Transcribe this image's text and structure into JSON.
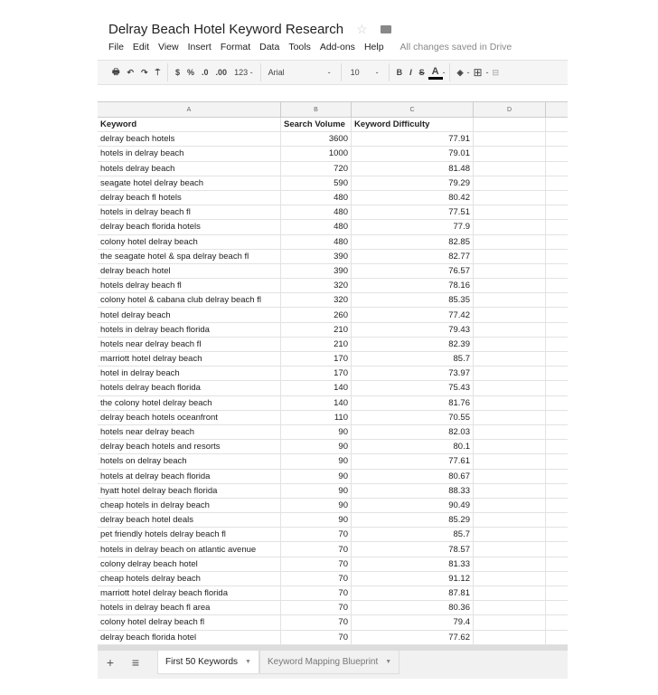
{
  "doc": {
    "title": "Delray Beach Hotel Keyword Research",
    "star_icon": "star-icon",
    "folder_icon": "folder-icon"
  },
  "menu": [
    "File",
    "Edit",
    "View",
    "Insert",
    "Format",
    "Data",
    "Tools",
    "Add-ons",
    "Help"
  ],
  "save_status": "All changes saved in Drive",
  "toolbar": {
    "currency": "$",
    "percent": "%",
    "dec_less": ".0",
    "dec_more": ".00",
    "format": "123 -",
    "font": "Arial",
    "font_dd": "-",
    "size": "10",
    "size_dd": "-",
    "bold": "B",
    "italic": "I",
    "strike": "S",
    "text_color": "A",
    "text_color_dd": "-",
    "fill_dd": "-",
    "borders": "⊞",
    "borders_dd": "-"
  },
  "columns": [
    "A",
    "B",
    "C",
    "D"
  ],
  "header": [
    "Keyword",
    "Search Volume",
    "Keyword Difficulty"
  ],
  "rows": [
    [
      "delray beach hotels",
      "3600",
      "77.91"
    ],
    [
      "hotels in delray beach",
      "1000",
      "79.01"
    ],
    [
      "hotels delray beach",
      "720",
      "81.48"
    ],
    [
      "seagate hotel delray beach",
      "590",
      "79.29"
    ],
    [
      "delray beach fl hotels",
      "480",
      "80.42"
    ],
    [
      "hotels in delray beach fl",
      "480",
      "77.51"
    ],
    [
      "delray beach florida hotels",
      "480",
      "77.9"
    ],
    [
      "colony hotel delray beach",
      "480",
      "82.85"
    ],
    [
      "the seagate hotel & spa delray beach fl",
      "390",
      "82.77"
    ],
    [
      "delray beach hotel",
      "390",
      "76.57"
    ],
    [
      "hotels delray beach fl",
      "320",
      "78.16"
    ],
    [
      "colony hotel & cabana club delray beach fl",
      "320",
      "85.35"
    ],
    [
      "hotel delray beach",
      "260",
      "77.42"
    ],
    [
      "hotels in delray beach florida",
      "210",
      "79.43"
    ],
    [
      "hotels near delray beach fl",
      "210",
      "82.39"
    ],
    [
      "marriott hotel delray beach",
      "170",
      "85.7"
    ],
    [
      "hotel in delray beach",
      "170",
      "73.97"
    ],
    [
      "hotels delray beach florida",
      "140",
      "75.43"
    ],
    [
      "the colony hotel delray beach",
      "140",
      "81.76"
    ],
    [
      "delray beach hotels oceanfront",
      "110",
      "70.55"
    ],
    [
      "hotels near delray beach",
      "90",
      "82.03"
    ],
    [
      "delray beach hotels and resorts",
      "90",
      "80.1"
    ],
    [
      "hotels on delray beach",
      "90",
      "77.61"
    ],
    [
      "hotels at delray beach florida",
      "90",
      "80.67"
    ],
    [
      "hyatt hotel delray beach florida",
      "90",
      "88.33"
    ],
    [
      "cheap hotels in delray beach",
      "90",
      "90.49"
    ],
    [
      "delray beach hotel deals",
      "90",
      "85.29"
    ],
    [
      "pet friendly hotels delray beach fl",
      "70",
      "85.7"
    ],
    [
      "hotels in delray beach on atlantic avenue",
      "70",
      "78.57"
    ],
    [
      "colony delray beach hotel",
      "70",
      "81.33"
    ],
    [
      "cheap hotels delray beach",
      "70",
      "91.12"
    ],
    [
      "marriott hotel delray beach florida",
      "70",
      "87.81"
    ],
    [
      "hotels in delray beach fl area",
      "70",
      "80.36"
    ],
    [
      "colony hotel delray beach fl",
      "70",
      "79.4"
    ],
    [
      "delray beach florida hotel",
      "70",
      "77.62"
    ]
  ],
  "sheets": {
    "add": "+",
    "list": "≡",
    "tabs": [
      "First 50 Keywords",
      "Keyword Mapping Blueprint"
    ],
    "active": 0
  }
}
